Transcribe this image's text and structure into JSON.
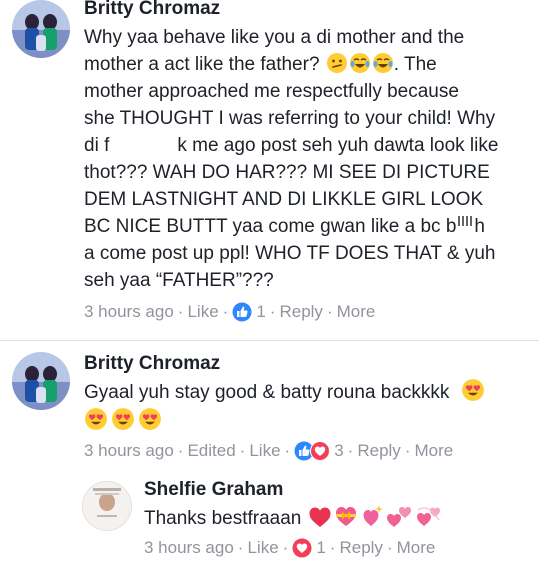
{
  "comments": [
    {
      "author": "Britty Chromaz",
      "lines": [
        "Why yaa behave like you a di mother and the",
        "mother a act like the father?",
        ". The",
        "mother approached me respectfully because",
        "she THOUGHT I was referring to your child! Why",
        "di f",
        "k me ago post seh yuh dawta look like",
        "thot??? WAH DO HAR??? MI SEE DI PICTURE",
        "DEM LASTNIGHT AND DI LIKKLE GIRL LOOK",
        "BC NICE BUTTT yaa come gwan like a bc b",
        "h",
        "a come post up ppl! WHO TF DOES THAT & yuh",
        "seh yaa “FATHER”???"
      ],
      "time": "3 hours ago",
      "like": "Like",
      "reaction_count": "1",
      "reply": "Reply",
      "more": "More"
    },
    {
      "author": "Britty Chromaz",
      "text": "Gyaal yuh stay good & batty rouna backkkk",
      "time": "3 hours ago",
      "edited": "Edited",
      "like": "Like",
      "reaction_count": "3",
      "reply": "Reply",
      "more": "More"
    },
    {
      "author": "Shelfie Graham",
      "text": "Thanks bestfraaan",
      "time": "3 hours ago",
      "like": "Like",
      "reaction_count": "1",
      "reply": "Reply",
      "more": "More"
    }
  ],
  "colors": {
    "name": "#1d2129",
    "meta": "#90949c",
    "like_blue": "#2d88ff",
    "love_red": "#f33e58",
    "emoji_yellow": "#ffcc33"
  }
}
